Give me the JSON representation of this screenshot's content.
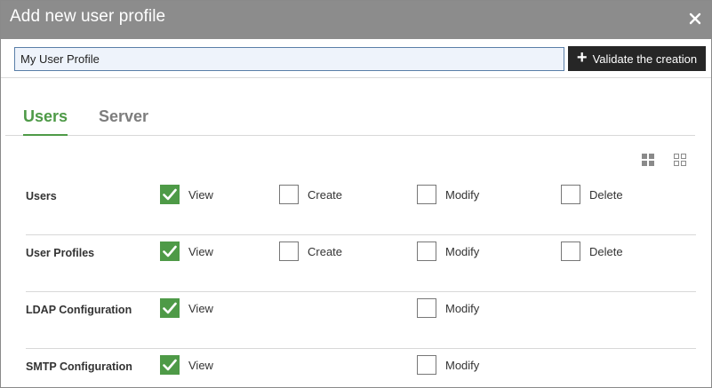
{
  "dialog": {
    "title": "Add new user profile",
    "close_icon": "close-icon"
  },
  "toolbar": {
    "profile_name_value": "My User Profile",
    "validate_label": "Validate the creation",
    "validate_icon": "plus-icon"
  },
  "tabs": [
    {
      "label": "Users",
      "active": true
    },
    {
      "label": "Server",
      "active": false
    }
  ],
  "view_toggles": [
    "grid-large-icon",
    "grid-small-icon"
  ],
  "rows": [
    {
      "label": "Users",
      "permissions": {
        "view": {
          "label": "View",
          "checked": true
        },
        "create": {
          "label": "Create",
          "checked": false
        },
        "modify": {
          "label": "Modify",
          "checked": false
        },
        "delete": {
          "label": "Delete",
          "checked": false
        }
      }
    },
    {
      "label": "User Profiles",
      "permissions": {
        "view": {
          "label": "View",
          "checked": true
        },
        "create": {
          "label": "Create",
          "checked": false
        },
        "modify": {
          "label": "Modify",
          "checked": false
        },
        "delete": {
          "label": "Delete",
          "checked": false
        }
      }
    },
    {
      "label": "LDAP Configuration",
      "permissions": {
        "view": {
          "label": "View",
          "checked": true
        },
        "modify": {
          "label": "Modify",
          "checked": false
        }
      }
    },
    {
      "label": "SMTP Configuration",
      "permissions": {
        "view": {
          "label": "View",
          "checked": true
        },
        "modify": {
          "label": "Modify",
          "checked": false
        }
      }
    }
  ],
  "colors": {
    "accent_green": "#4e9a47",
    "titlebar_gray": "#8c8c8c",
    "button_dark": "#262626"
  }
}
